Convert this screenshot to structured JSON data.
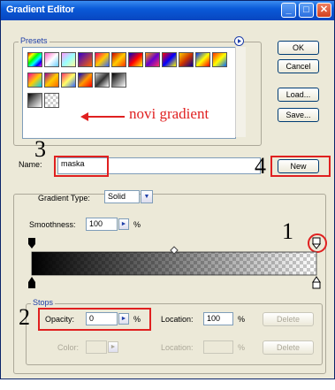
{
  "window": {
    "title": "Gradient Editor",
    "min_icon": "minimize-icon",
    "max_icon": "maximize-icon",
    "close_icon": "close-icon"
  },
  "presets": {
    "label": "Presets",
    "menu_icon": "arrow-right-circle-icon",
    "annotation": "novi gradient"
  },
  "buttons": {
    "ok": "OK",
    "cancel": "Cancel",
    "load": "Load...",
    "save": "Save...",
    "new": "New"
  },
  "name": {
    "label": "Name:",
    "value": "maska"
  },
  "gradient": {
    "type_label": "Gradient Type:",
    "type_value": "Solid",
    "smoothness_label": "Smoothness:",
    "smoothness_value": "100",
    "percent": "%"
  },
  "stops": {
    "label": "Stops",
    "opacity_label": "Opacity:",
    "opacity_value": "0",
    "opacity_unit": "%",
    "location_label": "Location:",
    "location_value": "100",
    "location_unit": "%",
    "delete": "Delete",
    "color_label": "Color:",
    "color_location_label": "Location:",
    "color_unit": "%",
    "color_delete": "Delete"
  },
  "annotations": {
    "n1": "1",
    "n2": "2",
    "n3": "3",
    "n4": "4"
  },
  "colors": {
    "accent": "#e02020",
    "titlebar": "#0a5ad8",
    "label_blue": "#1f3fa8"
  }
}
